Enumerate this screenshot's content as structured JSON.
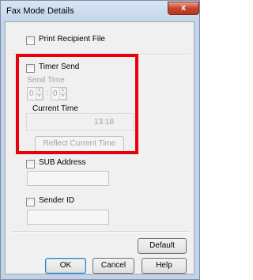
{
  "window": {
    "title": "Fax Mode Details",
    "close_label": "x"
  },
  "print_recipient_file": {
    "label": "Print Recipient File",
    "checked": false
  },
  "timer_send": {
    "label": "Timer Send",
    "checked": false,
    "send_time_label": "Send Time",
    "hour_value": "0",
    "minute_value": "0",
    "separator": ":",
    "current_time_label": "Current Time",
    "current_time_value": "13:18",
    "reflect_button_label": "Reflect Current Time"
  },
  "sub_address": {
    "label": "SUB Address",
    "checked": false,
    "value": ""
  },
  "sender_id": {
    "label": "Sender ID",
    "checked": false,
    "value": ""
  },
  "buttons": {
    "default_label": "Default",
    "ok_label": "OK",
    "cancel_label": "Cancel",
    "help_label": "Help"
  },
  "colors": {
    "highlight": "#e8000b",
    "title_bar": "#c4d5ea",
    "close_button": "#c7432b"
  }
}
